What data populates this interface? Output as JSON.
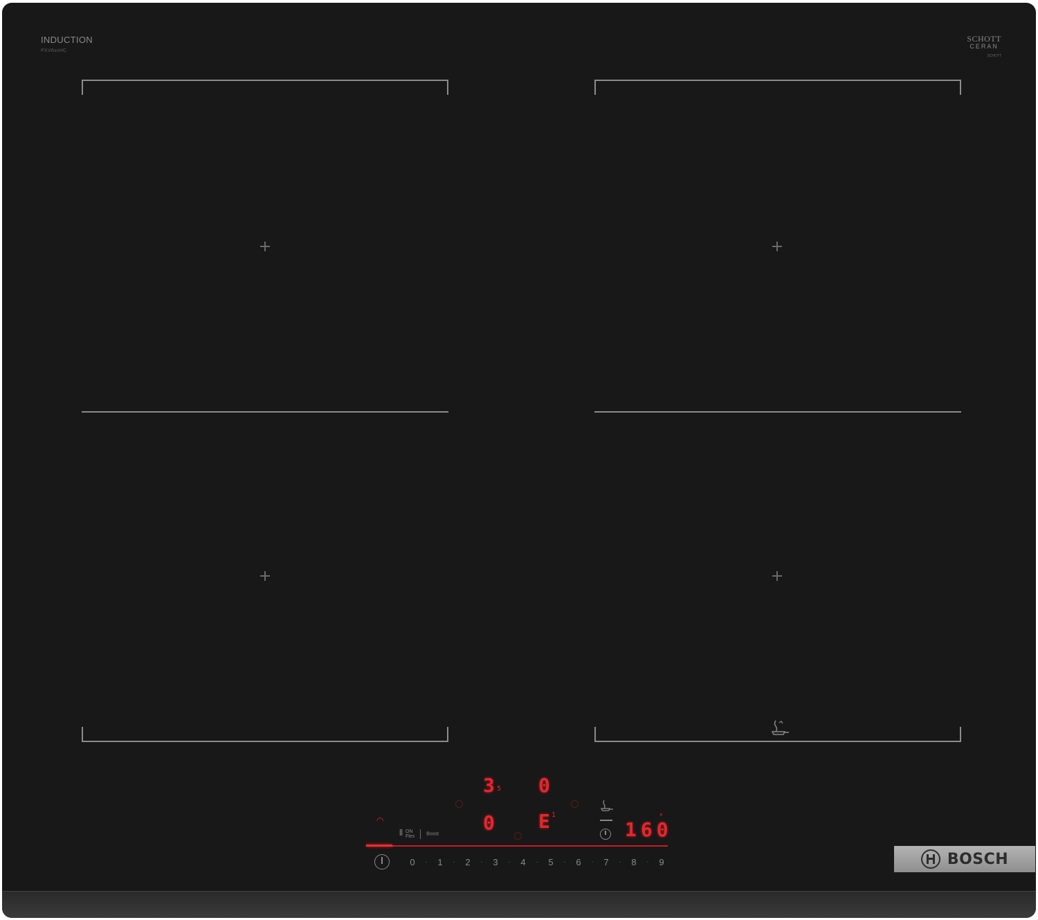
{
  "branding": {
    "induction_label": "INDUCTION",
    "model_label": "PXV6xxHC",
    "glass_brand_line1": "SCHOTT",
    "glass_brand_line2": "CERAN",
    "glass_brand_sub": "SCHOTT",
    "manufacturer": "BOSCH"
  },
  "displays": {
    "zone_top_left_level": "3",
    "zone_top_left_sub": "5",
    "zone_top_right_level": "0",
    "zone_bottom_left_level": "0",
    "zone_bottom_right_level": "E",
    "zone_bottom_right_sub": "1",
    "temperature_readout": "160"
  },
  "controls": {
    "function_label_a": "ON",
    "function_label_b": "Flex",
    "function_label_c": "Boost",
    "power_scale": [
      "0",
      "1",
      "2",
      "3",
      "4",
      "5",
      "6",
      "7",
      "8",
      "9"
    ]
  },
  "icons": {
    "power": "power-icon",
    "wifi": "wifi-icon",
    "timer": "timer-icon",
    "pan": "pan-sensor-icon",
    "zone_center": "plus-icon"
  },
  "colors": {
    "glass": "#181818",
    "display_red": "#e8252b",
    "marking_gray": "#8c8c8c",
    "badge_silver": "#a6a6a6"
  }
}
